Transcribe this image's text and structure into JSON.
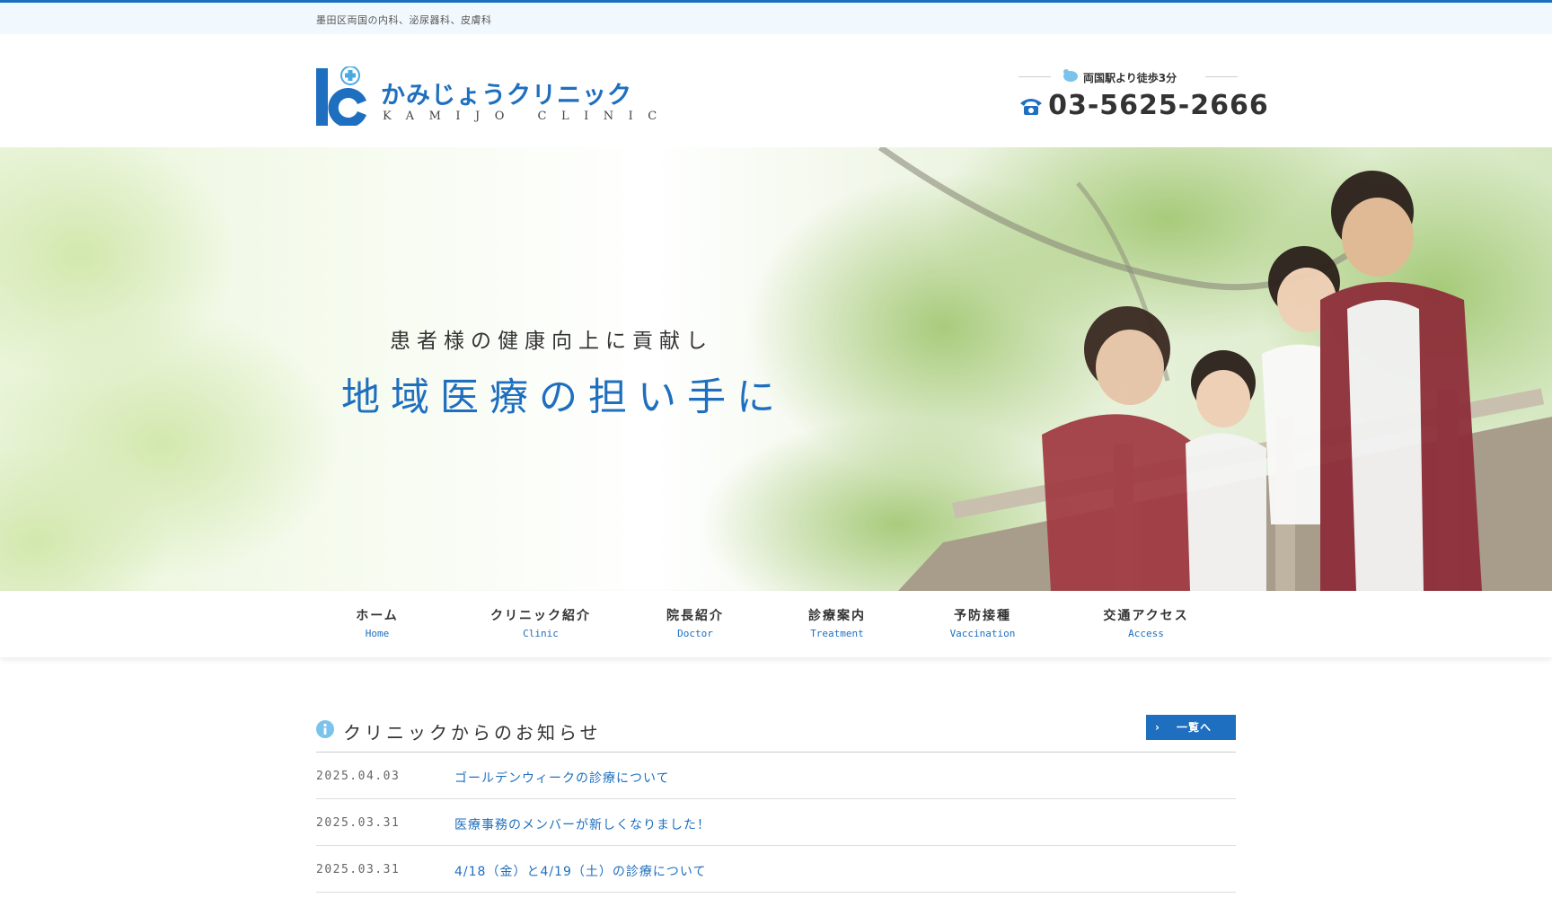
{
  "topbar": {
    "tagline": "墨田区両国の内科、泌尿器科、皮膚科"
  },
  "header": {
    "logo_jp": "かみじょうクリニック",
    "logo_en": "KAMIJO CLINIC",
    "access": "両国駅より徒歩3分",
    "phone": "03-5625-2666"
  },
  "hero": {
    "sub": "患者様の健康向上に貢献し",
    "main": "地域医療の担い手に"
  },
  "nav": {
    "items": [
      {
        "jp": "ホーム",
        "en": "Home"
      },
      {
        "jp": "クリニック紹介",
        "en": "Clinic"
      },
      {
        "jp": "院長紹介",
        "en": "Doctor"
      },
      {
        "jp": "診療案内",
        "en": "Treatment"
      },
      {
        "jp": "予防接種",
        "en": "Vaccination"
      },
      {
        "jp": "交通アクセス",
        "en": "Access"
      }
    ]
  },
  "news": {
    "title": "クリニックからのお知らせ",
    "more_label": "一覧へ",
    "items": [
      {
        "date": "2025.04.03",
        "title": "ゴールデンウィークの診療について"
      },
      {
        "date": "2025.03.31",
        "title": "医療事務のメンバーが新しくなりました！"
      },
      {
        "date": "2025.03.31",
        "title": "4/18（金）と4/19（土）の診療について"
      }
    ]
  },
  "colors": {
    "brand": "#1e6fbf",
    "topbar_bg": "#f2f9fe"
  },
  "icons": [
    "logo-mark-icon",
    "walk-icon",
    "phone-icon",
    "info-icon",
    "chevron-right-icon"
  ]
}
